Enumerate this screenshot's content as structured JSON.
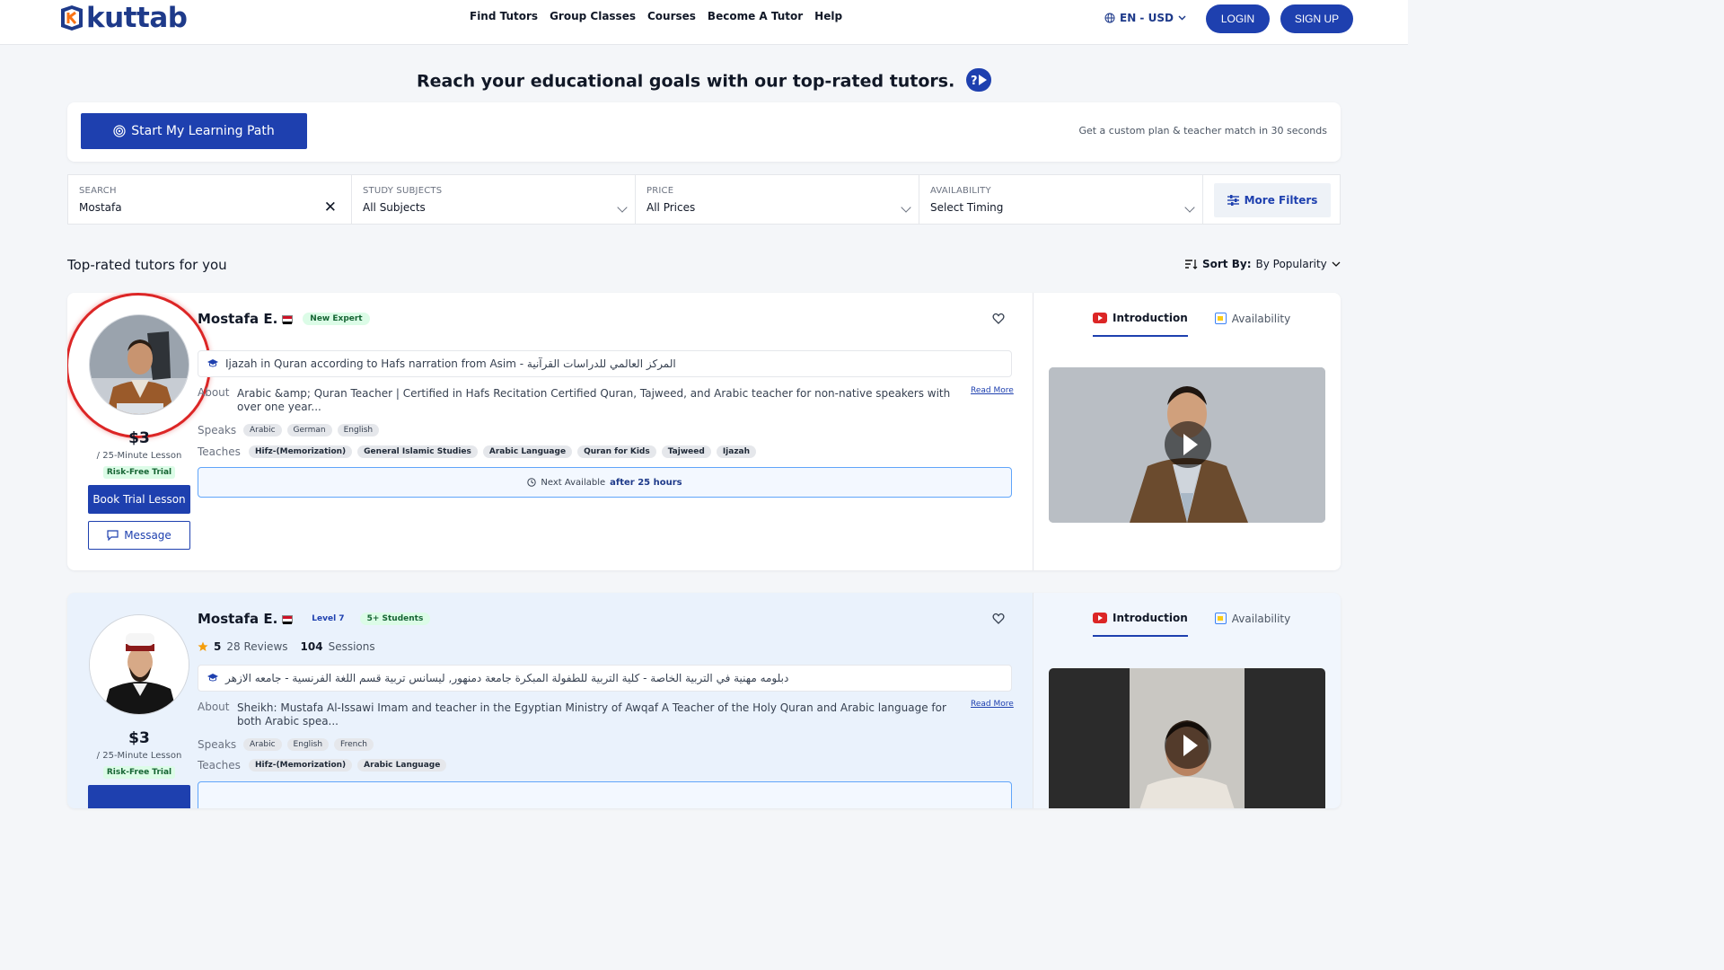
{
  "header": {
    "logo_text": "kuttab",
    "nav": [
      "Find Tutors",
      "Group Classes",
      "Courses",
      "Become A Tutor",
      "Help"
    ],
    "language": "EN - USD",
    "login": "LOGIN",
    "signup": "SIGN UP"
  },
  "hero": {
    "title": "Reach your educational goals with our top-rated tutors."
  },
  "learning_path": {
    "button": "Start My Learning Path",
    "note": "Get a custom plan & teacher match in 30 seconds"
  },
  "filters": {
    "search": {
      "label": "SEARCH",
      "value": "Mostafa"
    },
    "subjects": {
      "label": "STUDY SUBJECTS",
      "value": "All Subjects"
    },
    "price": {
      "label": "PRICE",
      "value": "All Prices"
    },
    "availability": {
      "label": "AVAILABILITY",
      "value": "Select Timing"
    },
    "more": "More Filters"
  },
  "list": {
    "heading": "Top-rated tutors for you",
    "sort_label": "Sort By:",
    "sort_value": "By Popularity"
  },
  "tutors": [
    {
      "name": "Mostafa E.",
      "badges": [
        "New Expert"
      ],
      "certificate": "Ijazah in Quran according to Hafs narration from Asim - المركز العالمي للدراسات القرآنية",
      "about_label": "About",
      "about": "Arabic &amp; Quran Teacher | Certified in Hafs Recitation Certified Quran, Tajweed, and Arabic teacher for non-native speakers with over one year...",
      "read_more": "Read More",
      "speaks_label": "Speaks",
      "speaks": [
        "Arabic",
        "German",
        "English"
      ],
      "teaches_label": "Teaches",
      "teaches": [
        "Hifz-(Memorization)",
        "General Islamic Studies",
        "Arabic Language",
        "Quran for Kids",
        "Tajweed",
        "Ijazah"
      ],
      "next_prefix": "Next Available",
      "next_value": "after 25 hours",
      "price": "$3",
      "per": "/ 25-Minute Lesson",
      "trial": "Risk-Free Trial",
      "book": "Book Trial Lesson",
      "message": "Message",
      "tab_intro": "Introduction",
      "tab_avail": "Availability"
    },
    {
      "name": "Mostafa E.",
      "badges": [
        "Level 7",
        "5+ Students"
      ],
      "rating": "5",
      "reviews": "28 Reviews",
      "sessions_count": "104",
      "sessions_label": "Sessions",
      "certificate": "دبلومه مهنية في التربية الخاصة - كلية التربية للطفولة المبكرة جامعة دمنهور, ليسانس تربية قسم اللغة الفرنسية - جامعه الازهر",
      "about_label": "About",
      "about": "Sheikh: Mustafa Al-Issawi Imam and teacher in the Egyptian Ministry of Awqaf A Teacher of the Holy Quran and Arabic language for both Arabic spea...",
      "read_more": "Read More",
      "speaks_label": "Speaks",
      "speaks": [
        "Arabic",
        "English",
        "French"
      ],
      "teaches_label": "Teaches",
      "teaches": [
        "Hifz-(Memorization)",
        "Arabic Language"
      ],
      "price": "$3",
      "per": "/ 25-Minute Lesson",
      "trial": "Risk-Free Trial",
      "tab_intro": "Introduction",
      "tab_avail": "Availability"
    }
  ],
  "colors": {
    "brand": "#1e40af",
    "highlight": "#dc2626"
  }
}
